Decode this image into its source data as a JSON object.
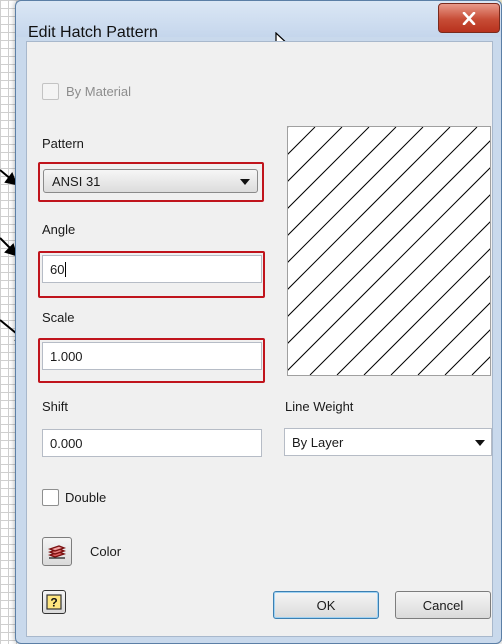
{
  "window": {
    "title": "Edit Hatch Pattern"
  },
  "form": {
    "by_material_label": "By Material",
    "pattern_label": "Pattern",
    "pattern_value": "ANSI 31",
    "angle_label": "Angle",
    "angle_value": "60",
    "scale_label": "Scale",
    "scale_value": "1.000",
    "shift_label": "Shift",
    "shift_value": "0.000",
    "line_weight_label": "Line Weight",
    "line_weight_value": "By Layer",
    "double_label": "Double",
    "color_label": "Color"
  },
  "buttons": {
    "ok": "OK",
    "cancel": "Cancel"
  },
  "icons": {
    "close": "close-x-icon",
    "color": "color-layers-icon",
    "help": "help-question-icon",
    "cursor": "mouse-pointer-icon"
  },
  "colors": {
    "highlight_box": "#c0141c",
    "close_button": "#c74c36",
    "title_bar": "#c9d9ec"
  }
}
